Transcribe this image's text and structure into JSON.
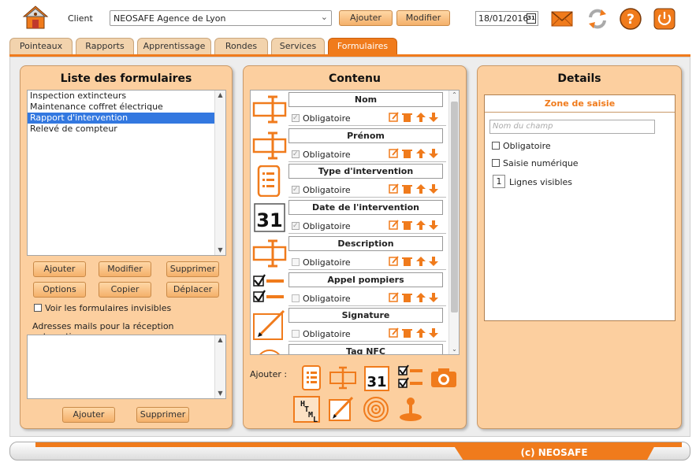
{
  "header": {
    "client_label": "Client",
    "client_value": "NEOSAFE Agence de Lyon",
    "add_button": "Ajouter",
    "edit_button": "Modifier",
    "date_value": "18/01/2016",
    "calendar_day": "31"
  },
  "tabs": [
    {
      "label": "Pointeaux",
      "active": false
    },
    {
      "label": "Rapports",
      "active": false
    },
    {
      "label": "Apprentissage",
      "active": false
    },
    {
      "label": "Rondes",
      "active": false
    },
    {
      "label": "Services",
      "active": false
    },
    {
      "label": "Formulaires",
      "active": true
    }
  ],
  "left_panel": {
    "title": "Liste des formulaires",
    "forms": [
      {
        "label": "Inspection extincteurs",
        "selected": false
      },
      {
        "label": "Maintenance coffret électrique",
        "selected": false
      },
      {
        "label": "Rapport d'intervention",
        "selected": true
      },
      {
        "label": "Relevé de compteur",
        "selected": false
      }
    ],
    "buttons": {
      "add": "Ajouter",
      "edit": "Modifier",
      "delete": "Supprimer",
      "options": "Options",
      "copy": "Copier",
      "move": "Déplacer"
    },
    "show_invisible_label": "Voir les formulaires invisibles",
    "mail_label": "Adresses mails pour la réception automatique",
    "mail_add": "Ajouter",
    "mail_delete": "Supprimer"
  },
  "content_panel": {
    "title": "Contenu",
    "obligatoire_label": "Obligatoire",
    "fields": [
      {
        "name": "Nom",
        "icon": "text-field-icon",
        "required": true
      },
      {
        "name": "Prénom",
        "icon": "text-field-icon",
        "required": true
      },
      {
        "name": "Type d'intervention",
        "icon": "list-icon",
        "required": true
      },
      {
        "name": "Date de l'intervention",
        "icon": "calendar-icon",
        "required": true
      },
      {
        "name": "Description",
        "icon": "text-field-icon",
        "required": false
      },
      {
        "name": "Appel pompiers",
        "icon": "checkbox-list-icon",
        "required": false
      },
      {
        "name": "Signature",
        "icon": "signature-icon",
        "required": false
      },
      {
        "name": "Tag NFC",
        "icon": "nfc-icon",
        "required": false
      }
    ],
    "add_label": "Ajouter :",
    "calendar_day": "31",
    "html_icon_text": "HTML"
  },
  "details_panel": {
    "title": "Details",
    "zone_title": "Zone de saisie",
    "field_name_placeholder": "Nom du champ",
    "required_label": "Obligatoire",
    "numeric_label": "Saisie numérique",
    "visible_lines_value": "1",
    "visible_lines_label": "Lignes visibles"
  },
  "footer": {
    "brand": "(c) NEOSAFE"
  },
  "colors": {
    "accent": "#f07b1c",
    "panel": "#fccf9f",
    "selection": "#3378e0"
  }
}
